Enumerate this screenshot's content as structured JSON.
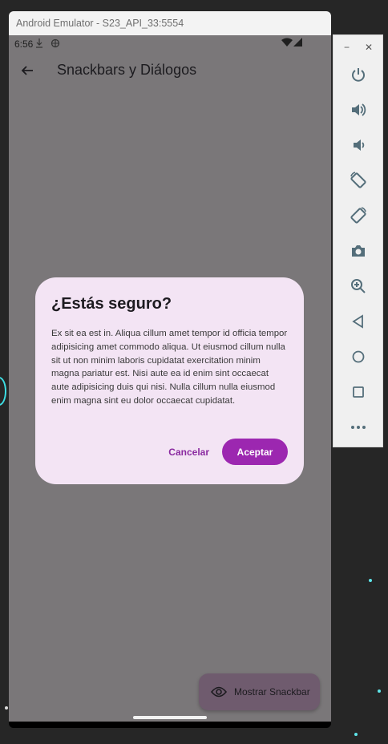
{
  "window": {
    "title": "Android Emulator - S23_API_33:5554"
  },
  "status_bar": {
    "time": "6:56",
    "left_icons": [
      "download-icon",
      "accessibility-icon"
    ],
    "right_icons": [
      "wifi-icon",
      "signal-icon"
    ]
  },
  "app_bar": {
    "back_icon": "arrow-back-icon",
    "title": "Snackbars y Diálogos"
  },
  "dialog": {
    "title": "¿Estás seguro?",
    "body": "Ex sit ea est in. Aliqua cillum amet tempor id officia tempor adipisicing amet commodo aliqua. Ut eiusmod cillum nulla sit ut non minim laboris cupidatat exercitation minim magna pariatur est. Nisi aute ea id enim sint occaecat aute adipisicing duis qui nisi. Nulla cillum nulla eiusmod enim magna sint eu dolor occaecat cupidatat.",
    "cancel_label": "Cancelar",
    "accept_label": "Aceptar"
  },
  "fab": {
    "icon": "eye-icon",
    "label": "Mostrar Snackbar"
  },
  "side_panel": {
    "window_controls": [
      "minimize-icon",
      "close-icon"
    ],
    "minimize_glyph": "−",
    "close_glyph": "✕",
    "tools": [
      "power-icon",
      "volume-up-icon",
      "volume-down-icon",
      "rotate-left-icon",
      "rotate-right-icon",
      "camera-icon",
      "zoom-icon",
      "back-icon",
      "home-icon",
      "overview-icon",
      "more-icon"
    ]
  },
  "colors": {
    "dialog_bg": "#f3e4f4",
    "accent": "#9c27b0",
    "scrim": "#7a7779",
    "fab_bg": "#6f5b6e"
  }
}
